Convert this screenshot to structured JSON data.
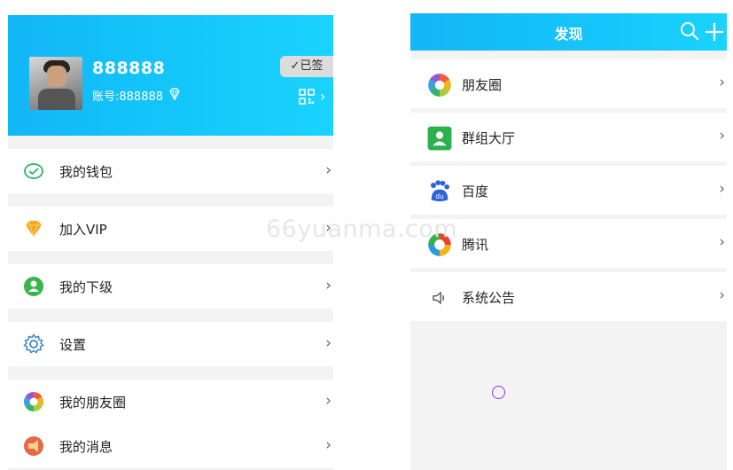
{
  "profile": {
    "nickname": "888888",
    "account": "账号:888888",
    "signed_label": "✓已签",
    "qr_arrow": "›"
  },
  "left_menu": [
    {
      "label": "我的钱包",
      "icon": "wallet-icon"
    },
    {
      "label": "加入VIP",
      "icon": "vip-diamond-icon"
    },
    {
      "label": "我的下级",
      "icon": "subordinate-user-icon"
    },
    {
      "label": "设置",
      "icon": "gear-icon"
    },
    {
      "label": "我的朋友圈",
      "icon": "moments-icon"
    },
    {
      "label": "我的消息",
      "icon": "message-icon"
    }
  ],
  "discover": {
    "title": "发现",
    "items": [
      {
        "label": "朋友圈",
        "icon": "moments-icon"
      },
      {
        "label": "群组大厅",
        "icon": "group-hall-icon"
      },
      {
        "label": "百度",
        "icon": "baidu-icon"
      },
      {
        "label": "腾讯",
        "icon": "tencent-icon"
      },
      {
        "label": "系统公告",
        "icon": "speaker-icon"
      }
    ]
  },
  "chevron": "›",
  "watermark": "66yuanma.com",
  "colors": {
    "header_blue": "#12b7f5",
    "header_cyan": "#1ad3ff",
    "background": "#f3f3f3"
  }
}
